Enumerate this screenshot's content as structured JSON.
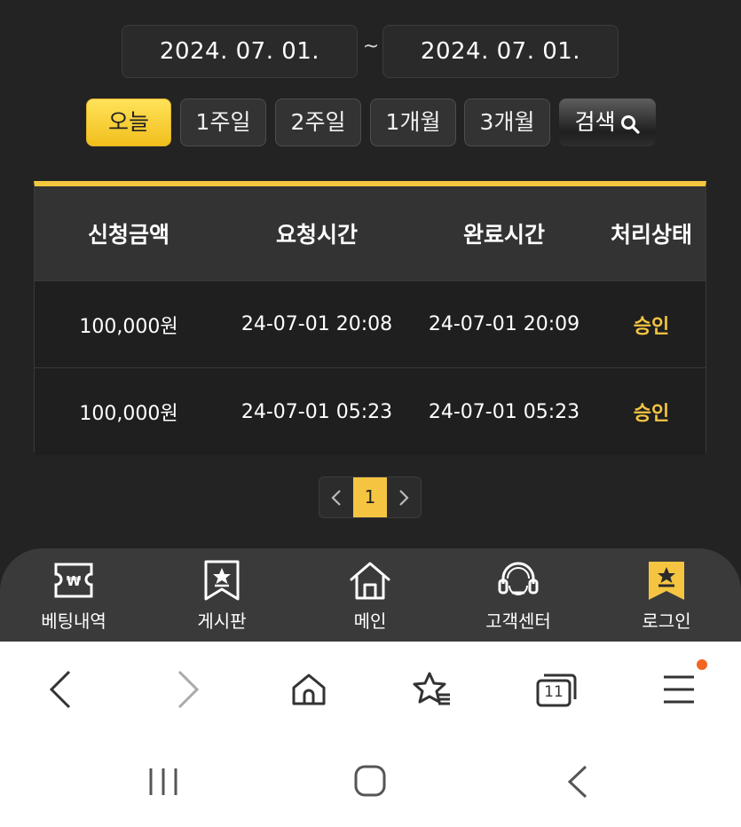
{
  "date_range": {
    "start": "2024. 07. 01.",
    "separator": "~",
    "end": "2024. 07. 01."
  },
  "quick_filters": [
    {
      "label": "오늘",
      "active": true
    },
    {
      "label": "1주일",
      "active": false
    },
    {
      "label": "2주일",
      "active": false
    },
    {
      "label": "1개월",
      "active": false
    },
    {
      "label": "3개월",
      "active": false
    }
  ],
  "search": {
    "label": "검색",
    "icon": "search-icon"
  },
  "table": {
    "headers": [
      "신청금액",
      "요청시간",
      "완료시간",
      "처리상태"
    ],
    "rows": [
      {
        "amount": "100,000원",
        "requested": "24-07-01 20:08",
        "completed": "24-07-01 20:09",
        "status": "승인"
      },
      {
        "amount": "100,000원",
        "requested": "24-07-01 05:23",
        "completed": "24-07-01 05:23",
        "status": "승인"
      }
    ]
  },
  "pagination": {
    "current": "1"
  },
  "bottom_nav": [
    {
      "label": "베팅내역",
      "icon": "betting-ticket-icon"
    },
    {
      "label": "게시판",
      "icon": "board-bookmark-icon"
    },
    {
      "label": "메인",
      "icon": "home-icon"
    },
    {
      "label": "고객센터",
      "icon": "headset-icon"
    },
    {
      "label": "로그인",
      "icon": "login-bookmark-icon"
    }
  ],
  "browser_bar": {
    "tab_count": "11"
  },
  "colors": {
    "accent": "#f5c542",
    "background": "#232323",
    "nav_background": "#3a3a3a"
  }
}
